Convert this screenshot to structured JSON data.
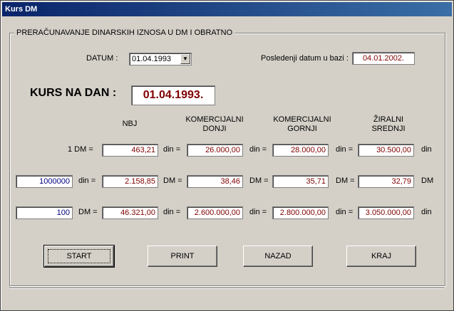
{
  "window": {
    "title": "Kurs  DM"
  },
  "group": {
    "title": "PRERAČUNAVANJE DINARSKIH IZNOSA U DM I OBRATNO"
  },
  "datum": {
    "label": "DATUM :",
    "value": "01.04.1993"
  },
  "last_date": {
    "label": "Posledenji datum u bazi :",
    "value": "04.01.2002."
  },
  "kurs": {
    "label": "KURS NA DAN :",
    "date": "01.04.1993."
  },
  "columns": {
    "nbj": "NBJ",
    "kom_donji_1": "KOMERCIJALNI",
    "kom_donji_2": "DONJI",
    "kom_gornji_1": "KOMERCIJALNI",
    "kom_gornji_2": "GORNJI",
    "ziralni_1": "ŽIRALNI",
    "ziralni_2": "SREDNJI"
  },
  "row1": {
    "label": "1 DM =",
    "nbj": "463,21",
    "unit1": "din =",
    "donji": "26.000,00",
    "unit2": "din =",
    "gornji": "28.000,00",
    "unit3": "din =",
    "ziralni": "30.500,00",
    "unit4": "din"
  },
  "row2": {
    "input": "1000000",
    "label": "din  =",
    "nbj": "2.158,85",
    "unit1": "DM =",
    "donji": "38,46",
    "unit2": "DM =",
    "gornji": "35,71",
    "unit3": "DM =",
    "ziralni": "32,79",
    "unit4": "DM"
  },
  "row3": {
    "input": "100",
    "label": "DM  =",
    "nbj": "46.321,00",
    "unit1": "din =",
    "donji": "2.600.000,00",
    "unit2": "din =",
    "gornji": "2.800.000,00",
    "unit3": "din =",
    "ziralni": "3.050.000,00",
    "unit4": "din"
  },
  "buttons": {
    "start": "START",
    "print": "PRINT",
    "nazad": "NAZAD",
    "kraj": "KRAJ"
  },
  "icons": {
    "combo_arrow": "chevron-down-icon"
  }
}
